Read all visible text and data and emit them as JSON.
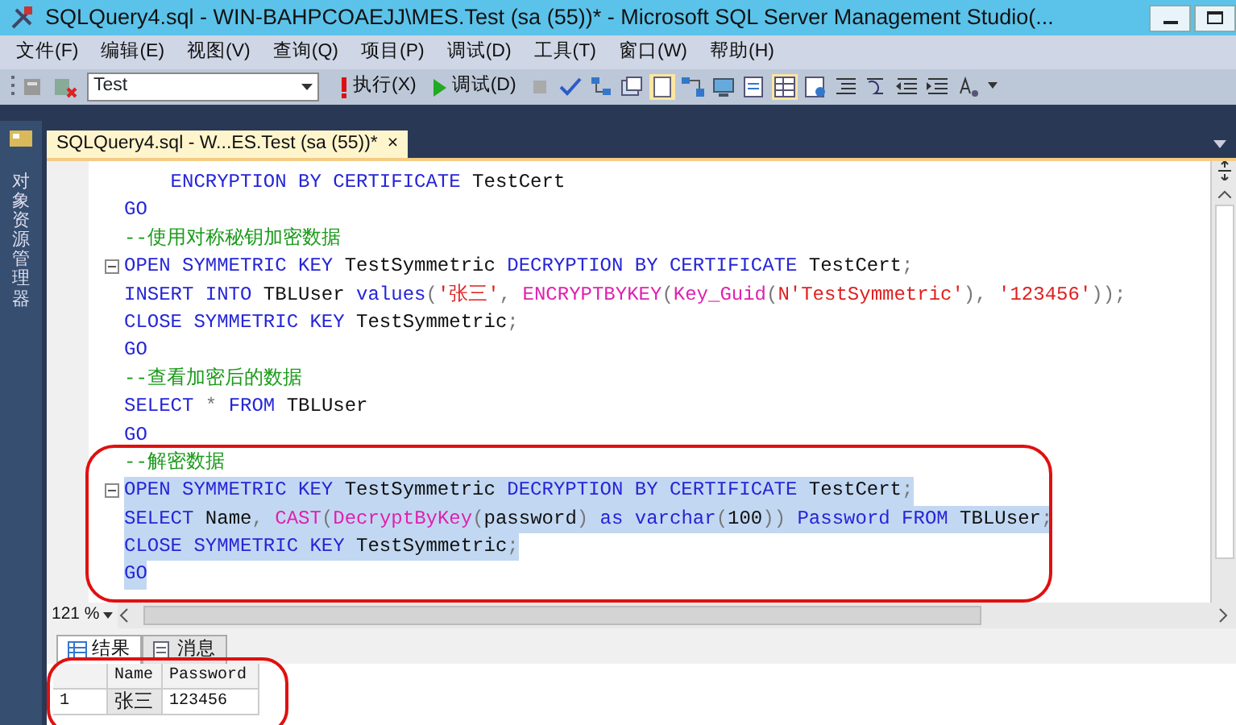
{
  "window": {
    "title": "SQLQuery4.sql - WIN-BAHPCOAEJJ\\MES.Test (sa (55))* - Microsoft SQL Server Management Studio(..."
  },
  "menu": [
    "文件(F)",
    "编辑(E)",
    "视图(V)",
    "查询(Q)",
    "项目(P)",
    "调试(D)",
    "工具(T)",
    "窗口(W)",
    "帮助(H)"
  ],
  "toolbar": {
    "database": "Test",
    "execute": "执行(X)",
    "debug": "调试(D)"
  },
  "sidebar": {
    "label": "对象资源管理器"
  },
  "document_tab": {
    "title": "SQLQuery4.sql - W...ES.Test (sa (55))*",
    "close": "×"
  },
  "code": {
    "lines": [
      {
        "selected": false,
        "fold": false,
        "tokens": [
          {
            "kind": "keyword",
            "text": "    ENCRYPTION BY CERTIFICATE"
          },
          {
            "kind": "plain",
            "text": " TestCert"
          }
        ]
      },
      {
        "selected": false,
        "fold": false,
        "tokens": [
          {
            "kind": "keyword",
            "text": "GO"
          }
        ]
      },
      {
        "selected": false,
        "fold": false,
        "tokens": [
          {
            "kind": "comment",
            "text": "--使用对称秘钥加密数据"
          }
        ]
      },
      {
        "selected": false,
        "fold": true,
        "tokens": [
          {
            "kind": "keyword",
            "text": "OPEN SYMMETRIC KEY"
          },
          {
            "kind": "plain",
            "text": " TestSymmetric "
          },
          {
            "kind": "keyword",
            "text": "DECRYPTION BY CERTIFICATE"
          },
          {
            "kind": "plain",
            "text": " TestCert"
          },
          {
            "kind": "punct",
            "text": ";"
          }
        ]
      },
      {
        "selected": false,
        "fold": false,
        "tokens": [
          {
            "kind": "keyword",
            "text": "INSERT INTO"
          },
          {
            "kind": "plain",
            "text": " TBLUser "
          },
          {
            "kind": "keyword",
            "text": "values"
          },
          {
            "kind": "punct",
            "text": "("
          },
          {
            "kind": "string",
            "text": "'张三'"
          },
          {
            "kind": "punct",
            "text": ", "
          },
          {
            "kind": "function",
            "text": "ENCRYPTBYKEY"
          },
          {
            "kind": "punct",
            "text": "("
          },
          {
            "kind": "function",
            "text": "Key_Guid"
          },
          {
            "kind": "punct",
            "text": "("
          },
          {
            "kind": "string",
            "text": "N'TestSymmetric'"
          },
          {
            "kind": "punct",
            "text": "), "
          },
          {
            "kind": "string",
            "text": "'123456'"
          },
          {
            "kind": "punct",
            "text": "));"
          }
        ]
      },
      {
        "selected": false,
        "fold": false,
        "tokens": [
          {
            "kind": "keyword",
            "text": "CLOSE SYMMETRIC KEY"
          },
          {
            "kind": "plain",
            "text": " TestSymmetric"
          },
          {
            "kind": "punct",
            "text": ";"
          }
        ]
      },
      {
        "selected": false,
        "fold": false,
        "tokens": [
          {
            "kind": "keyword",
            "text": "GO"
          }
        ]
      },
      {
        "selected": false,
        "fold": false,
        "tokens": [
          {
            "kind": "comment",
            "text": "--查看加密后的数据"
          }
        ]
      },
      {
        "selected": false,
        "fold": false,
        "tokens": [
          {
            "kind": "keyword",
            "text": "SELECT"
          },
          {
            "kind": "punct",
            "text": " * "
          },
          {
            "kind": "keyword",
            "text": "FROM"
          },
          {
            "kind": "plain",
            "text": " TBLUser"
          }
        ]
      },
      {
        "selected": false,
        "fold": false,
        "tokens": [
          {
            "kind": "keyword",
            "text": "GO"
          }
        ]
      },
      {
        "selected": false,
        "fold": false,
        "tokens": [
          {
            "kind": "comment",
            "text": "--解密数据"
          }
        ]
      },
      {
        "selected": true,
        "fold": true,
        "tokens": [
          {
            "kind": "keyword",
            "text": "OPEN SYMMETRIC KEY"
          },
          {
            "kind": "plain",
            "text": " TestSymmetric "
          },
          {
            "kind": "keyword",
            "text": "DECRYPTION BY CERTIFICATE"
          },
          {
            "kind": "plain",
            "text": " TestCert"
          },
          {
            "kind": "punct",
            "text": ";"
          }
        ]
      },
      {
        "selected": true,
        "fold": false,
        "tokens": [
          {
            "kind": "keyword",
            "text": "SELECT"
          },
          {
            "kind": "plain",
            "text": " Name"
          },
          {
            "kind": "punct",
            "text": ", "
          },
          {
            "kind": "function",
            "text": "CAST"
          },
          {
            "kind": "punct",
            "text": "("
          },
          {
            "kind": "function",
            "text": "DecryptByKey"
          },
          {
            "kind": "punct",
            "text": "("
          },
          {
            "kind": "plain",
            "text": "password"
          },
          {
            "kind": "punct",
            "text": ") "
          },
          {
            "kind": "keyword",
            "text": "as varchar"
          },
          {
            "kind": "punct",
            "text": "("
          },
          {
            "kind": "plain",
            "text": "100"
          },
          {
            "kind": "punct",
            "text": ")) "
          },
          {
            "kind": "keyword",
            "text": "Password FROM"
          },
          {
            "kind": "plain",
            "text": " TBLUser"
          },
          {
            "kind": "punct",
            "text": ";"
          }
        ]
      },
      {
        "selected": true,
        "fold": false,
        "tokens": [
          {
            "kind": "keyword",
            "text": "CLOSE SYMMETRIC KEY"
          },
          {
            "kind": "plain",
            "text": " TestSymmetric"
          },
          {
            "kind": "punct",
            "text": ";"
          }
        ]
      },
      {
        "selected": true,
        "fold": false,
        "tokens": [
          {
            "kind": "keyword",
            "text": "GO"
          }
        ]
      }
    ]
  },
  "zoom": "121 %",
  "result_tabs": [
    {
      "label": "结果",
      "selected": true
    },
    {
      "label": "消息",
      "selected": false
    }
  ],
  "results": {
    "columns": [
      "Name",
      "Password"
    ],
    "rows": [
      {
        "number": "1",
        "cells": [
          "张三",
          "123456"
        ]
      }
    ]
  }
}
